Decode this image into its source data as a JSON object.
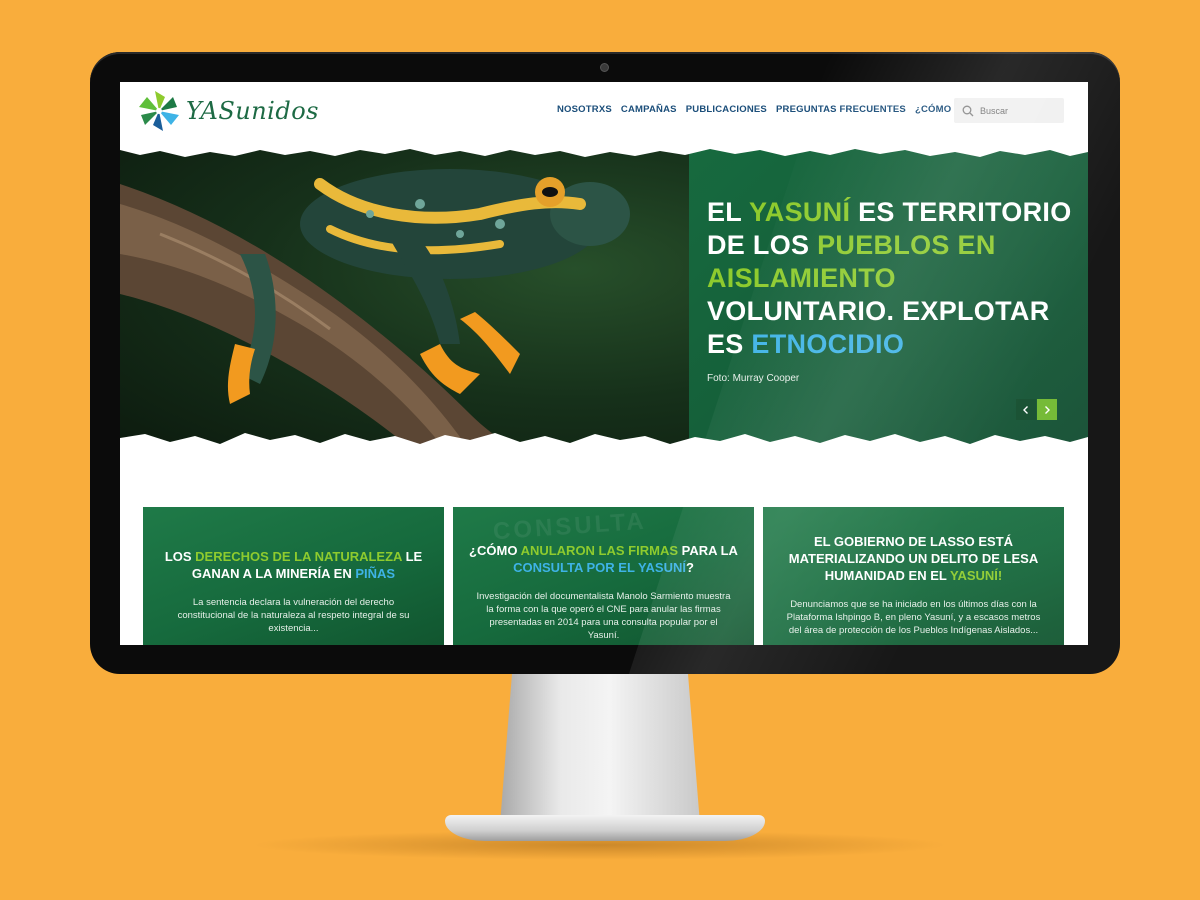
{
  "site": {
    "logo_text": "YASunidos"
  },
  "nav": {
    "items": [
      "NOSOTRXS",
      "CAMPAÑAS",
      "PUBLICACIONES",
      "PREGUNTAS FRECUENTES",
      "¿CÓMO APOYAR?"
    ]
  },
  "search": {
    "placeholder": "Buscar"
  },
  "hero": {
    "title_parts": [
      {
        "text": "EL ",
        "color": "white"
      },
      {
        "text": "YASUNÍ",
        "color": "green"
      },
      {
        "text": " ES TERRITORIO DE LOS ",
        "color": "white"
      },
      {
        "text": "PUEBLOS EN AISLAMIENTO",
        "color": "green"
      },
      {
        "text": " VOLUNTARIO. EXPLOTAR ES ",
        "color": "white"
      },
      {
        "text": "ETNOCIDIO",
        "color": "blue"
      }
    ],
    "caption": "Foto: Murray Cooper"
  },
  "cards": [
    {
      "title_parts": [
        {
          "text": "LOS ",
          "color": "white"
        },
        {
          "text": "DERECHOS DE LA NATURALEZA",
          "color": "green"
        },
        {
          "text": " LE GANAN A LA MINERÍA EN ",
          "color": "white"
        },
        {
          "text": "PIÑAS",
          "color": "blue"
        }
      ],
      "text": "La sentencia declara la vulneración del derecho constitucional de la naturaleza al respeto integral de su existencia..."
    },
    {
      "watermark": "CONSULTA",
      "title_parts": [
        {
          "text": "¿CÓMO ",
          "color": "white"
        },
        {
          "text": "ANULARON LAS FIRMAS",
          "color": "green"
        },
        {
          "text": " PARA LA ",
          "color": "white"
        },
        {
          "text": "CONSULTA POR EL YASUNÍ",
          "color": "blue"
        },
        {
          "text": "?",
          "color": "white"
        }
      ],
      "text": "Investigación del documentalista Manolo Sarmiento muestra la forma con la que operó el CNE para anular las firmas presentadas en 2014 para una consulta popular por el Yasuní."
    },
    {
      "title_parts": [
        {
          "text": "EL GOBIERNO DE LASSO ESTÁ MATERIALIZANDO UN DELITO DE LESA HUMANIDAD EN EL ",
          "color": "white"
        },
        {
          "text": "YASUNÍ!",
          "color": "green"
        }
      ],
      "text": "Denunciamos que se ha iniciado en los últimos días con la Plataforma Ishpingo B, en pleno Yasuní, y a escasos metros del área de protección de los Pueblos Indígenas Aislados..."
    }
  ],
  "colors": {
    "background": "#f9ad3c",
    "brand_green": "#155a37",
    "accent_green": "#8ecb2e",
    "accent_blue": "#3eb3e6",
    "nav_blue": "#1b4e7a"
  },
  "icons": {
    "search": "search-icon",
    "prev": "chevron-left-icon",
    "next": "chevron-right-icon",
    "logo": "pinwheel-logo-icon"
  }
}
